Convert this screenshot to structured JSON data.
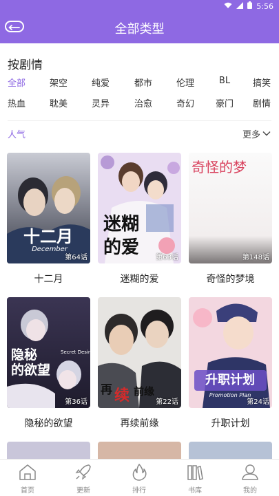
{
  "status_bar": {
    "time": "5:56"
  },
  "header": {
    "title": "全部类型",
    "back_icon": "back-arrow-icon"
  },
  "filter": {
    "title": "按剧情",
    "rows": [
      [
        "全部",
        "架空",
        "纯爱",
        "都市",
        "伦理",
        "BL",
        "搞笑"
      ],
      [
        "热血",
        "耽美",
        "灵异",
        "治愈",
        "奇幻",
        "豪门",
        "剧情"
      ]
    ],
    "active": "全部"
  },
  "sort": {
    "label": "人气",
    "more_label": "更多"
  },
  "comics": [
    {
      "title": "十二月",
      "episodes": "第64话",
      "cover_text": "十二月",
      "cover_sub": "December"
    },
    {
      "title": "迷糊的爱",
      "episodes": "第63话",
      "cover_text": "迷糊的爱"
    },
    {
      "title": "奇怪的梦境",
      "episodes": "第148话",
      "cover_text": "奇怪的梦"
    },
    {
      "title": "隐秘的欲望",
      "episodes": "第36话",
      "cover_text": "隐秘的欲望",
      "cover_sub": "Secret Desire"
    },
    {
      "title": "再续前缘",
      "episodes": "第22话",
      "cover_text": "再续前缘"
    },
    {
      "title": "升职计划",
      "episodes": "第24话",
      "cover_text": "升职计划",
      "cover_sub": "Promotion Plan"
    }
  ],
  "tabs": [
    {
      "label": "首页",
      "icon": "home-icon"
    },
    {
      "label": "更新",
      "icon": "rocket-icon"
    },
    {
      "label": "排行",
      "icon": "flame-icon"
    },
    {
      "label": "书库",
      "icon": "books-icon"
    },
    {
      "label": "我的",
      "icon": "profile-icon"
    }
  ],
  "colors": {
    "accent": "#8e69e3",
    "text": "#222222",
    "muted": "#888888"
  }
}
